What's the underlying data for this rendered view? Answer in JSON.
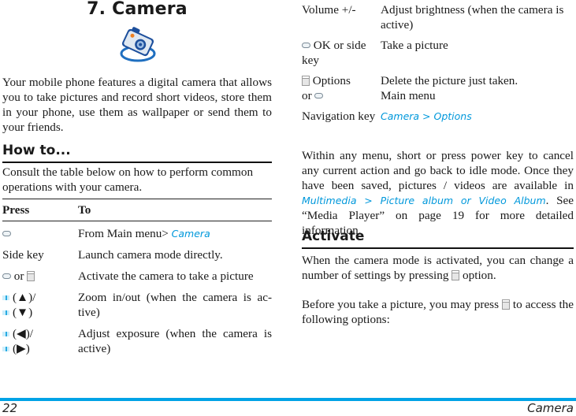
{
  "chapter": {
    "title": "7. Camera",
    "icon": "camera-icon"
  },
  "intro": "Your mobile phone features a digital camera that allows you to take pictures and record short videos, store them in your phone, use them as wallpaper or send them to your friends.",
  "howto": {
    "heading": "How to...",
    "text": "Consult the table below on how to perform common operations with your camera.",
    "table": {
      "headers": [
        "Press",
        "To"
      ],
      "rows": [
        {
          "press_icon": "ok-key-icon",
          "press": "",
          "to": "From Main menu> ",
          "to_link": "Camera"
        },
        {
          "press": "Side key",
          "to": "Launch camera mode directly."
        },
        {
          "press_icons": [
            "ok-key-icon",
            "softkey-icon"
          ],
          "press_or": "or",
          "to": "Activate the camera to take a picture"
        },
        {
          "press_lines": [
            "(▲)/",
            "(▼)"
          ],
          "press_icon": "navigation-key-icon",
          "to": "Zoom in/out (when the camera is ac-tive)"
        },
        {
          "press_lines": [
            "(◀)/",
            "(▶)"
          ],
          "press_icon": "navigation-key-icon",
          "to": "Adjust exposure (when the camera is active)"
        }
      ]
    }
  },
  "right_table": {
    "rows": [
      {
        "press": "Volume +/-",
        "to": "Adjust brightness (when the camera is active)"
      },
      {
        "press_icon": "ok-key-icon",
        "press": " OK or side key",
        "to": "Take a picture"
      },
      {
        "press_icon": "softkey-icon",
        "press": " Options",
        "press_line2": "or ",
        "press_icon2": "ok-key-icon",
        "to": "Delete the picture just taken.",
        "to_line2": "Main menu"
      },
      {
        "press": "Navigation key",
        "to_link": "Camera > Options"
      }
    ]
  },
  "within": {
    "text_before": "Within any menu, short or press power key to cancel any current action and go back to idle mode. Once they have been saved, pictures / videos are available in ",
    "link": "Multimedia > Picture album or Video Album",
    "text_after": ". See “Media Player” on page 19 for more detailed information."
  },
  "activate": {
    "heading": "Activate",
    "p1_before": "When the camera mode is activated, you can change a number of settings by pressing ",
    "p1_after": " option.",
    "p2_before": "Before you take a picture, you may press ",
    "p2_after": " to access the following options:"
  },
  "footer": {
    "page_number": "22",
    "chapter_name": "Camera",
    "accent_color": "#00a3e6"
  },
  "colors": {
    "link": "#0098db"
  }
}
